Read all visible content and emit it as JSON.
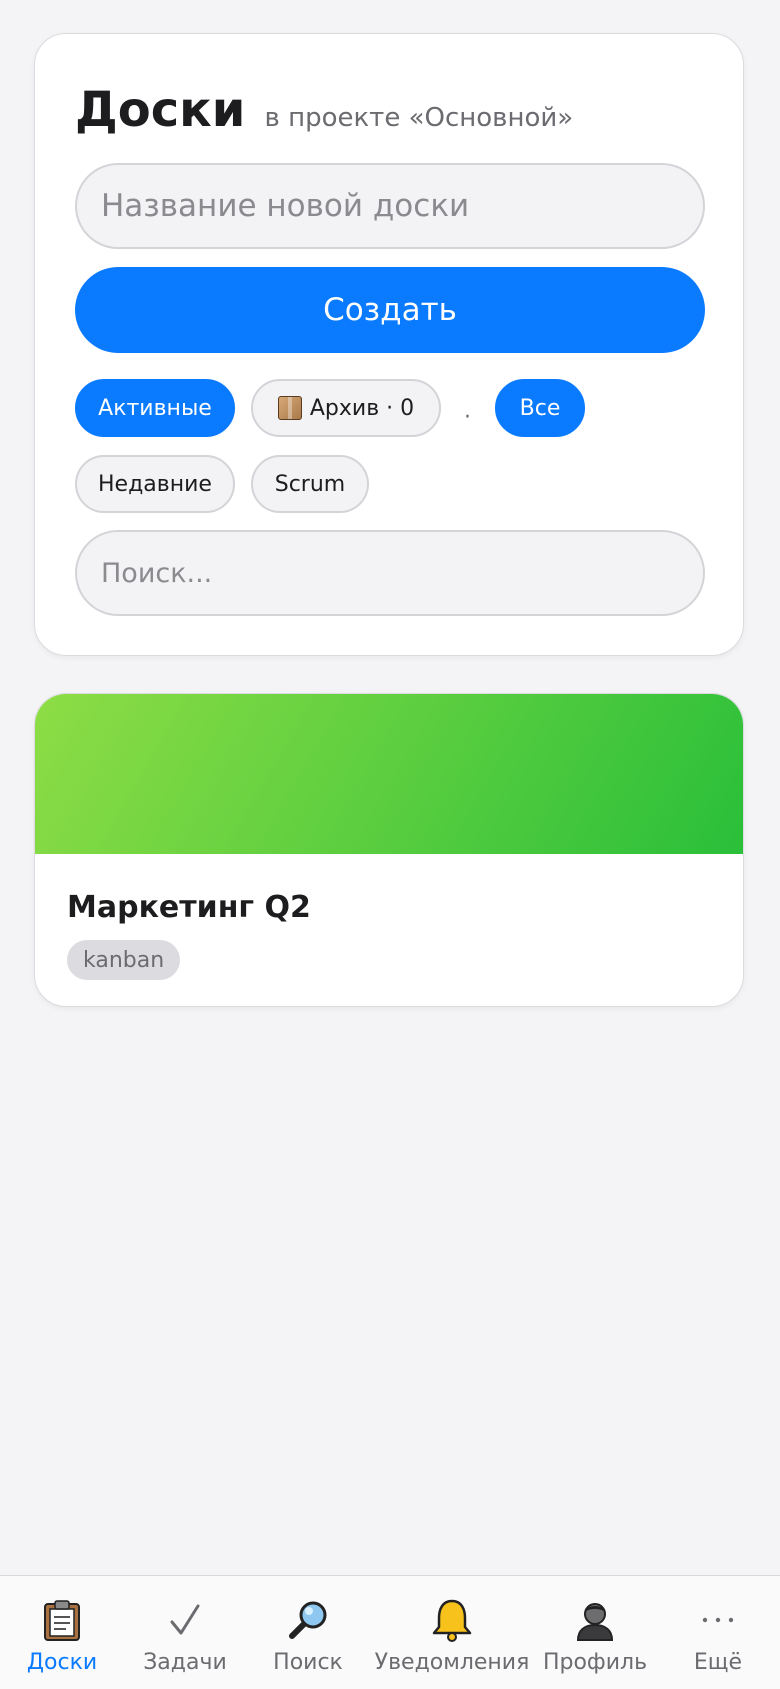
{
  "header": {
    "title": "Доски",
    "subtitle": "в проекте «Основной»"
  },
  "new_board": {
    "placeholder": "Название новой доски",
    "create_label": "Создать"
  },
  "filters": {
    "active_label": "Активные",
    "archive_label": "Архив · 0",
    "separator": "·",
    "all_label": "Все",
    "recent_label": "Недавние",
    "scrum_label": "Scrum"
  },
  "search": {
    "placeholder": "Поиск..."
  },
  "boards": [
    {
      "name": "Маркетинг Q2",
      "tag": "kanban",
      "cover_colors": [
        "#8edd45",
        "#2abf3a"
      ]
    }
  ],
  "tabbar": {
    "items": [
      {
        "label": "Доски",
        "icon": "clipboard-icon",
        "active": true
      },
      {
        "label": "Задачи",
        "icon": "checkmark-icon"
      },
      {
        "label": "Поиск",
        "icon": "magnifier-icon"
      },
      {
        "label": "Уведомления",
        "icon": "bell-icon"
      },
      {
        "label": "Профиль",
        "icon": "person-icon"
      },
      {
        "label": "Ещё",
        "icon": "more-icon"
      }
    ]
  },
  "colors": {
    "accent": "#0a7aff",
    "background": "#f4f4f6",
    "text": "#1d1d1f",
    "muted": "#6b6b70"
  }
}
